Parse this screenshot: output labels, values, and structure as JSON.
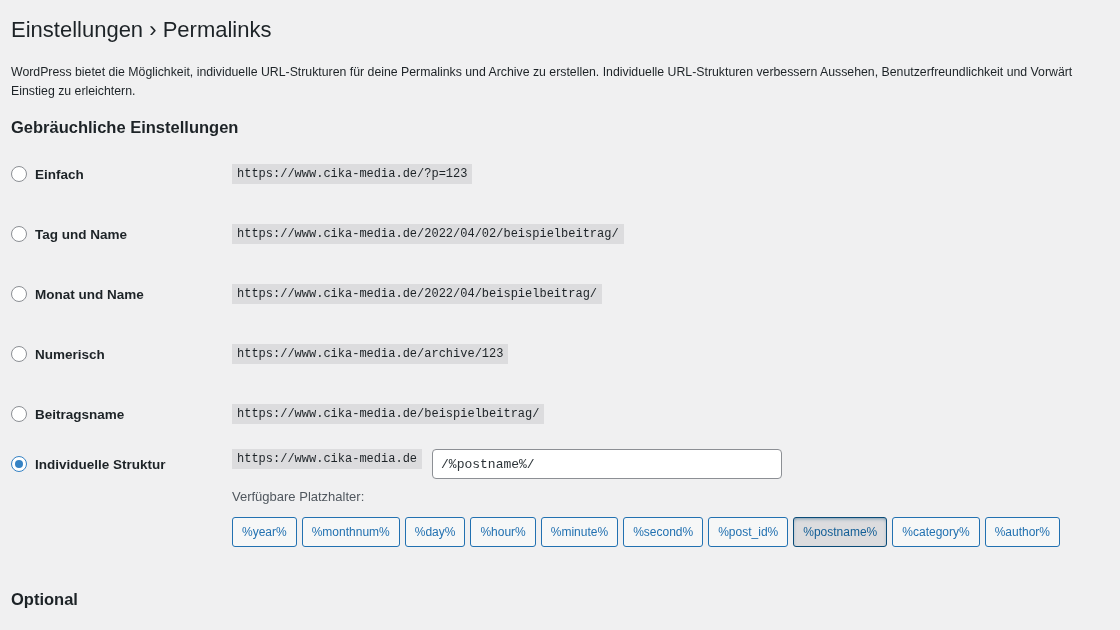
{
  "title": "Einstellungen › Permalinks",
  "intro_lines": [
    "WordPress bietet die Möglichkeit, individuelle URL-Strukturen für deine Permalinks und Archive zu erstellen. Individuelle URL-Strukturen verbessern Aussehen, Benutzerfreundlichkeit und Vorwärt",
    "Einstieg zu erleichtern."
  ],
  "section_common": "Gebräuchliche Einstellungen",
  "options": [
    {
      "label": "Einfach",
      "example": "https://www.cika-media.de/?p=123",
      "selected": false
    },
    {
      "label": "Tag und Name",
      "example": "https://www.cika-media.de/2022/04/02/beispielbeitrag/",
      "selected": false
    },
    {
      "label": "Monat und Name",
      "example": "https://www.cika-media.de/2022/04/beispielbeitrag/",
      "selected": false
    },
    {
      "label": "Numerisch",
      "example": "https://www.cika-media.de/archive/123",
      "selected": false
    },
    {
      "label": "Beitragsname",
      "example": "https://www.cika-media.de/beispielbeitrag/",
      "selected": false
    },
    {
      "label": "Individuelle Struktur",
      "example": "https://www.cika-media.de",
      "selected": true,
      "kind": "custom"
    }
  ],
  "custom_structure": {
    "value": "/%postname%/",
    "placeholders_label": "Verfügbare Platzhalter:"
  },
  "placeholders": [
    {
      "label": "%year%",
      "selected": false
    },
    {
      "label": "%monthnum%",
      "selected": false
    },
    {
      "label": "%day%",
      "selected": false
    },
    {
      "label": "%hour%",
      "selected": false
    },
    {
      "label": "%minute%",
      "selected": false
    },
    {
      "label": "%second%",
      "selected": false
    },
    {
      "label": "%post_id%",
      "selected": false
    },
    {
      "label": "%postname%",
      "selected": true
    },
    {
      "label": "%category%",
      "selected": false
    },
    {
      "label": "%author%",
      "selected": false
    }
  ],
  "section_optional": "Optional"
}
